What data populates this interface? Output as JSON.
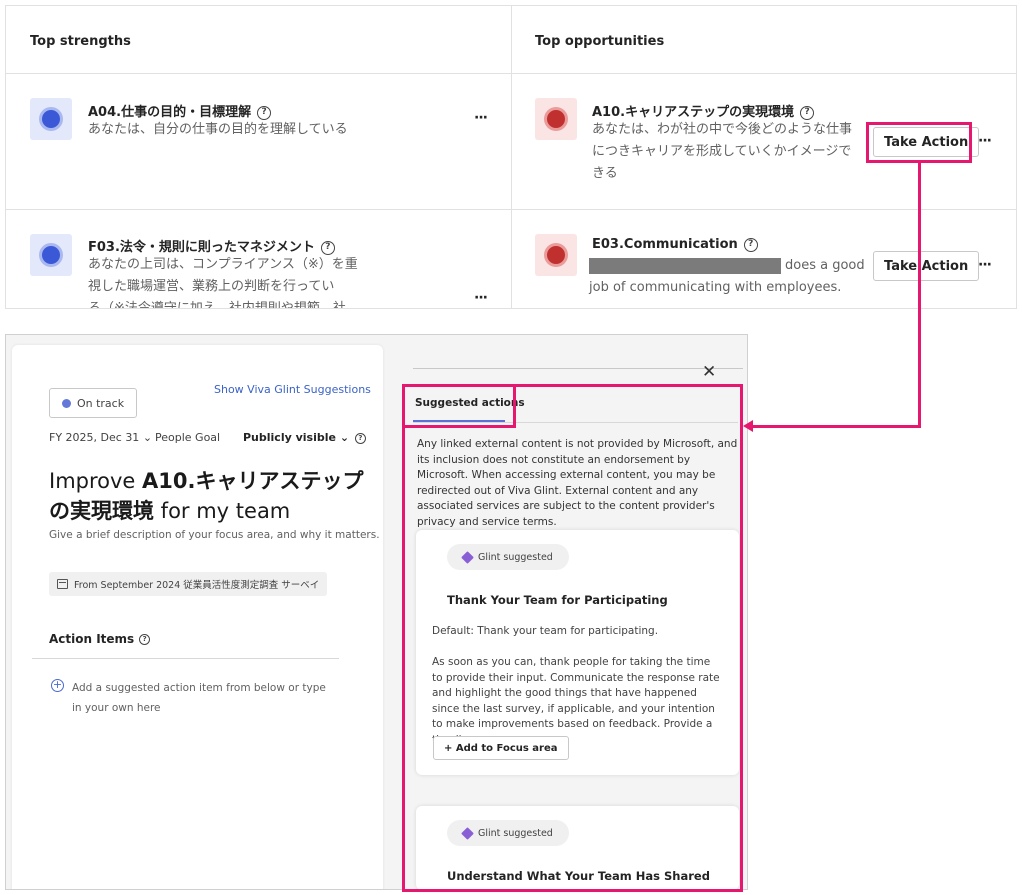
{
  "top_panel": {
    "strengths_header": "Top strengths",
    "opportunities_header": "Top opportunities",
    "strengths": [
      {
        "title": "A04.仕事の目的・目標理解",
        "desc": "あなたは、自分の仕事の目的を理解している",
        "icon": "blue-circle-icon"
      },
      {
        "title": "F03.法令・規則に則ったマネジメント",
        "desc": "あなたの上司は、コンプライアンス（※）を重視した職場運営、業務上の判断を行ってい",
        "desc_cut": "る（※法令遵守に加え、社内規則や規範、社",
        "icon": "blue-circle-icon"
      }
    ],
    "opportunities": [
      {
        "title": "A10.キャリアステップの実現環境",
        "desc": "あなたは、わが社の中で今後どのような仕事につきキャリアを形成していくかイメージできる",
        "icon": "red-circle-icon"
      },
      {
        "title": "E03.Communication",
        "desc_after_redact": "does a good",
        "desc_line2": "job of communicating with employees.",
        "icon": "red-circle-icon"
      }
    ],
    "take_action_label": "Take Action",
    "more_label": "···"
  },
  "focus_panel": {
    "status_label": "On track",
    "show_suggestions_link": "Show Viva Glint Suggestions",
    "due_label": "FY 2025, Dec 31",
    "goal_type": "People Goal",
    "visibility_label": "Publicly visible",
    "title_prefix": "Improve ",
    "title_main": "A10.キャリアステップの実現環境",
    "title_suffix": " for my team",
    "description_placeholder": "Give a brief description of your focus area, and why it matters.",
    "source_label": "From September 2024 従業員活性度測定調査 サーベイ",
    "action_items_title": "Action Items",
    "add_item_hint": "Add a suggested action item from below or type in your own here"
  },
  "suggested_panel": {
    "close_label": "✕",
    "tab_label": "Suggested actions",
    "disclaimer": "Any linked external content is not provided by Microsoft, and its inclusion does not constitute an endorsement by Microsoft. When accessing external content, you may be redirected out of Viva Glint. External content and any associated services are subject to the content provider's privacy and service terms.",
    "cards": [
      {
        "chip": "Glint suggested",
        "title": "Thank Your Team for Participating",
        "default_text": "Default: Thank your team for participating.",
        "body": "As soon as you can, thank people for taking the time to provide their input. Communicate the response rate and highlight the good things that have happened since the last survey, if applicable, and your intention to make improvements based on feedback. Provide a timeline.",
        "add_button": "+ Add to Focus area"
      },
      {
        "chip": "Glint suggested",
        "title": "Understand What Your Team Has Shared"
      }
    ]
  },
  "colors": {
    "highlight": "#e5176e",
    "accent_blue": "#3b59d6",
    "accent_red": "#c0302f",
    "link": "#3a63c7"
  }
}
